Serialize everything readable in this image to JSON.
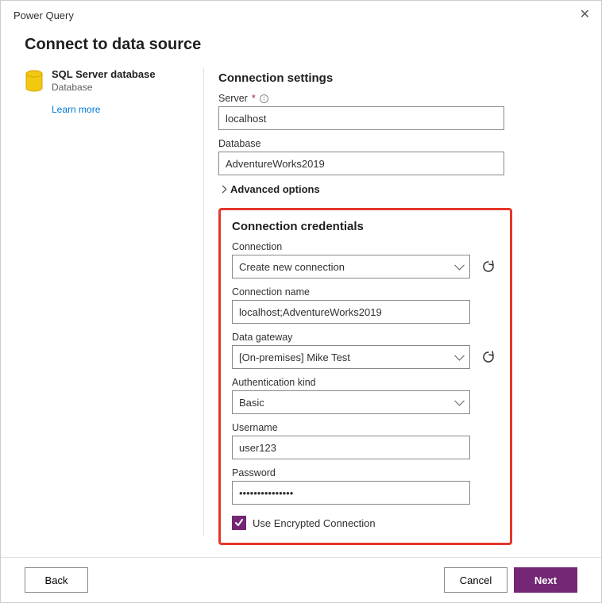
{
  "window": {
    "title": "Power Query"
  },
  "page": {
    "heading": "Connect to data source"
  },
  "source": {
    "title": "SQL Server database",
    "subtitle": "Database",
    "learn_more": "Learn more"
  },
  "settings": {
    "heading": "Connection settings",
    "server_label": "Server",
    "server_value": "localhost",
    "database_label": "Database",
    "database_value": "AdventureWorks2019",
    "advanced_label": "Advanced options"
  },
  "credentials": {
    "heading": "Connection credentials",
    "connection_label": "Connection",
    "connection_value": "Create new connection",
    "conn_name_label": "Connection name",
    "conn_name_value": "localhost;AdventureWorks2019",
    "gateway_label": "Data gateway",
    "gateway_value": "[On-premises] Mike Test",
    "auth_label": "Authentication kind",
    "auth_value": "Basic",
    "username_label": "Username",
    "username_value": "user123",
    "password_label": "Password",
    "password_value": "•••••••••••••••",
    "encrypted_label": "Use Encrypted Connection",
    "encrypted_checked": true
  },
  "footer": {
    "back": "Back",
    "cancel": "Cancel",
    "next": "Next"
  }
}
